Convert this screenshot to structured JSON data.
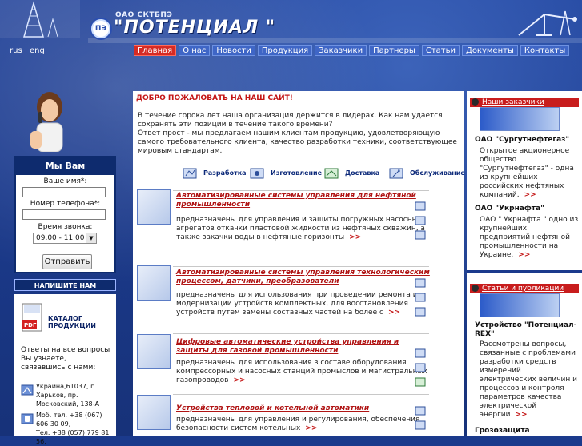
{
  "header": {
    "company_small": "ОАО СКТБПЭ",
    "company_big": "\"ПОТЕНЦИАЛ \"",
    "logo_letters": "ПЭ"
  },
  "lang": {
    "rus": "rus",
    "eng": "eng"
  },
  "nav": {
    "items": [
      "Главная",
      "О нас",
      "Новости",
      "Продукция",
      "Заказчики",
      "Партнеры",
      "Статьи",
      "Документы",
      "Контакты"
    ],
    "active": "Главная"
  },
  "callback": {
    "title": "Мы Вам перезвоним",
    "name_label": "Ваше имя*:",
    "phone_label": "Номер телефона*:",
    "time_label": "Время звонка:",
    "time_value": "09.00 - 11.00",
    "submit": "Отправить"
  },
  "message_button": "НАПИШИТЕ НАМ СООБЩЕНИЕ",
  "catalog": {
    "icon_caption": "PDF",
    "label": "КАТАЛОГ ПРОДУКЦИИ"
  },
  "faq": "Ответы на все  вопросы Вы узнаете, связавшись с нами:",
  "contacts": {
    "address": "Украина,61037, г. Харьков, пр. Московский, 138-А",
    "phones": "Моб. тел. +38 (067) 606 30 09,\nТел. +38 (057) 779 81 56,"
  },
  "welcome": "ДОБРО ПОЖАЛОВАТЬ НА НАШ САЙТ!",
  "intro": "В течение сорока лет наша организация держится в лидерах. Как нам удается сохранять эти позиции в течение такого времени?\nОтвет прост - мы предлагаем нашим клиентам продукцию, удовлетворяющую самого требовательного клиента, качество разработки техники, соответствующее мировым стандартам.",
  "services": [
    "Разработка",
    "Изготовление",
    "Доставка",
    "Обслуживание"
  ],
  "products": [
    {
      "title": "Автоматизированные системы управления для нефтяной промышленности",
      "desc": "предназначены для управления и защиты погружных насосных агрегатов откачки пластовой жидкости из нефтяных скважин, а также закачки воды в нефтяные горизонты",
      "more": ">>"
    },
    {
      "title": "Автоматизированные системы управления технологическим процессом, датчики, преобразователи",
      "desc": "предназначены для использования при проведении ремонта и модернизации устройств комплектных,  для восстановления устройств путем замены составных частей на более с",
      "more": ">>"
    },
    {
      "title": "Цифровые автоматические устройства управления и защиты для газовой промышленности",
      "desc": "предназначены для использования в составе оборудования компрессорных и насосных станций промыслов и магистральных газопроводов",
      "more": ">>"
    },
    {
      "title": "Устройства тепловой и котельной автоматики",
      "desc": "предназначены для управления и регулирования, обеспечения безопасности систем котельных",
      "more": ">>"
    }
  ],
  "right": {
    "customers_head": "Наши заказчики",
    "c1_title": "ОАО \"Сургутнефтегаз\"",
    "c1_text": "Открытое акционерное общество \"Сургутнефтегаз\" - одна из крупнейших российских нефтяных компаний.",
    "c2_title": "ОАО \"Укрнафта\"",
    "c2_text": "ОАО \" Укрнафта \" одно из крупнейших предприятий нефтяной промышленности на Украине.",
    "articles_head": "Статьи и публикации",
    "a1_title": "Устройство \"Потенциал-REX\"",
    "a1_text": "Рассмотрены вопросы, связанные с проблемами разработки средств измерений электрических величин и процессов и контроля параметров качества электрической энергии",
    "a2_title": "Грозозащита",
    "more": ">>"
  }
}
